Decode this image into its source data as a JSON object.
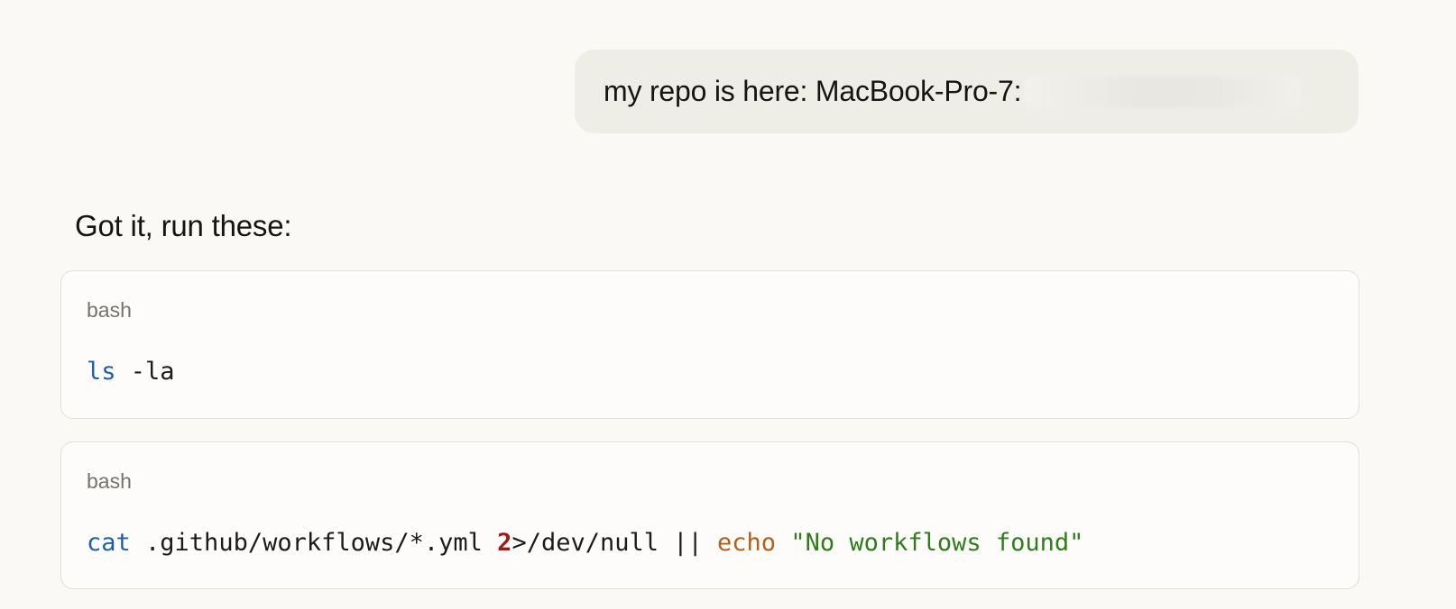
{
  "user_message": {
    "text": "my repo is here: MacBook-Pro-7:"
  },
  "assistant_message": {
    "text": "Got it, run these:"
  },
  "code_blocks": [
    {
      "language": "bash",
      "tokens": {
        "cmd": "ls",
        "rest": " -la"
      }
    },
    {
      "language": "bash",
      "tokens": {
        "cmd": "cat",
        "path": " .github/workflows/*.yml ",
        "fd": "2",
        "redirect": ">/dev/null || ",
        "builtin": "echo",
        "space": " ",
        "string": "\"No workflows found\""
      }
    }
  ],
  "colors": {
    "background": "#faf9f6",
    "user_bubble": "#efeee6",
    "code_bg": "#fdfcfa",
    "keyword_blue": "#1f5fa8",
    "number_red": "#a01818",
    "builtin_orange": "#b0611a",
    "string_green": "#2e7d1a"
  }
}
